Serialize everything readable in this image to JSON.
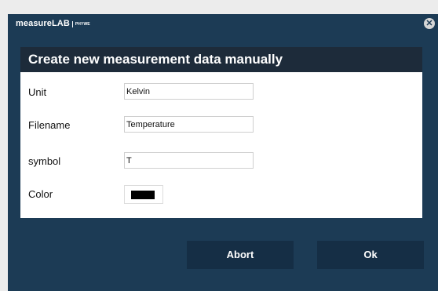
{
  "window": {
    "brand_name": "measureLAB",
    "brand_sub": "PHYWE",
    "close_glyph": "✕"
  },
  "dialog": {
    "title": "Create new measurement data manually"
  },
  "form": {
    "unit": {
      "label": "Unit",
      "value": "Kelvin"
    },
    "filename": {
      "label": "Filename",
      "value": "Temperature"
    },
    "symbol": {
      "label": "symbol",
      "value": "T"
    },
    "color": {
      "label": "Color",
      "value": "#000000"
    }
  },
  "buttons": {
    "abort_label": "Abort",
    "ok_label": "Ok"
  },
  "colors": {
    "dialog_bg": "#1c3b55",
    "header_bg": "#1d2b3a",
    "button_bg": "#152e45"
  }
}
